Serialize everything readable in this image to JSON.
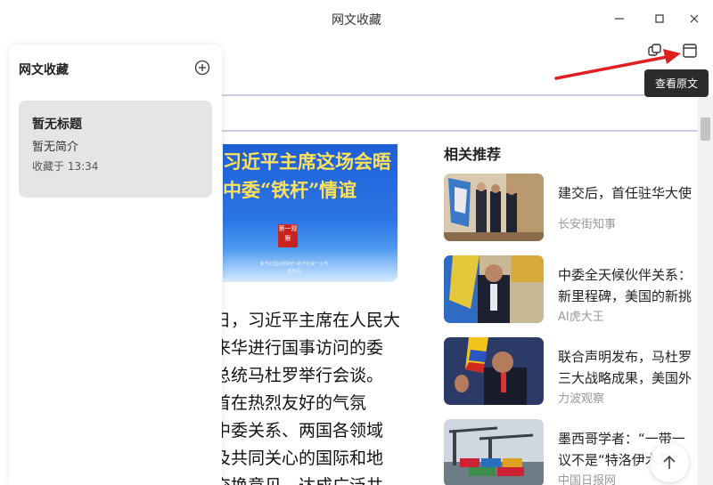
{
  "window": {
    "title": "网文收藏"
  },
  "sidebar": {
    "title": "网文收藏",
    "card": {
      "title": "暂无标题",
      "subtitle": "暂无简介",
      "saved_time": "收藏于 13:34"
    }
  },
  "tooltip": "查看原文",
  "article": {
    "image_headline_1": "习近平主席这场会晤",
    "image_headline_2": "中委“铁杆”情谊",
    "image_seal": "第一观察",
    "image_credit": "新华社国内部制作 新华社第一工作室出品",
    "lines": [
      "日，习近平主席在人民大",
      "来华进行国事访问的委",
      "总统马杜罗举行会谈。",
      "首在热烈友好的气氛",
      "中委关系、两国各领域",
      "及共同关心的国际和地",
      "交换意见，达成广泛共"
    ]
  },
  "recommendations": {
    "heading": "相关推荐",
    "items": [
      {
        "title": [
          "建交后，首任驻华大使"
        ],
        "source": "长安街知事",
        "image": "flag-meeting-photo"
      },
      {
        "title": [
          "中委全天候伙伴关系：",
          "新里程碑，美国的新挑"
        ],
        "source": "AI虎大王",
        "image": "maduro-meeting-photo"
      },
      {
        "title": [
          "联合声明发布，马杜罗",
          "三大战略成果，美国外"
        ],
        "source": "力波观察",
        "image": "maduro-speech-photo"
      },
      {
        "title": [
          "墨西哥学者：“一带一",
          "议不是“特洛伊木马”"
        ],
        "source": "中国日报网",
        "image": "port-cranes-photo"
      }
    ]
  },
  "colors": {
    "accent_arrow": "#e02020",
    "tooltip_bg": "#2b2b2b",
    "card_bg": "#e5e5e5"
  }
}
